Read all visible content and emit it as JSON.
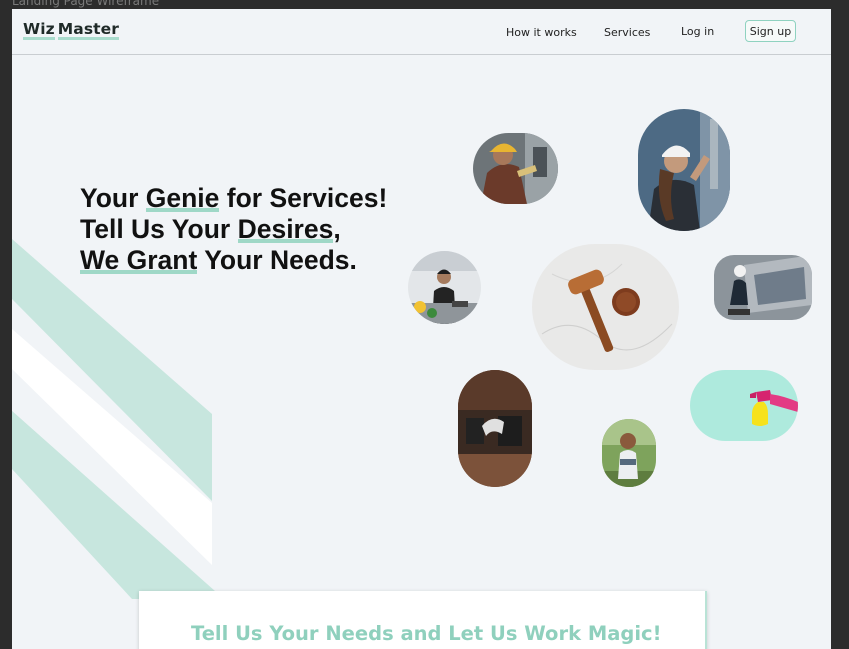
{
  "frame_label": "Landing Page Wireframe",
  "nav": {
    "logo_word1": "Wiz",
    "logo_word2": "Master",
    "how_it_works": "How it works",
    "services": "Services",
    "log_in": "Log in",
    "sign_up": "Sign up"
  },
  "hero": {
    "line1_a": "Your ",
    "line1_b": "Genie",
    "line1_c": " for Services!",
    "line2_a": "Tell Us Your ",
    "line2_b": "Desires",
    "line2_c": ",",
    "line3_a": "We Grant",
    "line3_b": " Your Needs."
  },
  "card": {
    "title": "Tell Us Your Needs and Let Us Work Magic!"
  },
  "colors": {
    "accent": "#a9dccd",
    "accent_text": "#8fd0bd",
    "page_bg": "#f1f4f7",
    "stripe": "#c7e6de"
  },
  "images": [
    "electrician-photo",
    "technician-woman-photo",
    "chef-photo",
    "gavel-photo",
    "cleaner-photo",
    "tool-belt-photo",
    "child-photo",
    "spray-bottle-photo"
  ]
}
